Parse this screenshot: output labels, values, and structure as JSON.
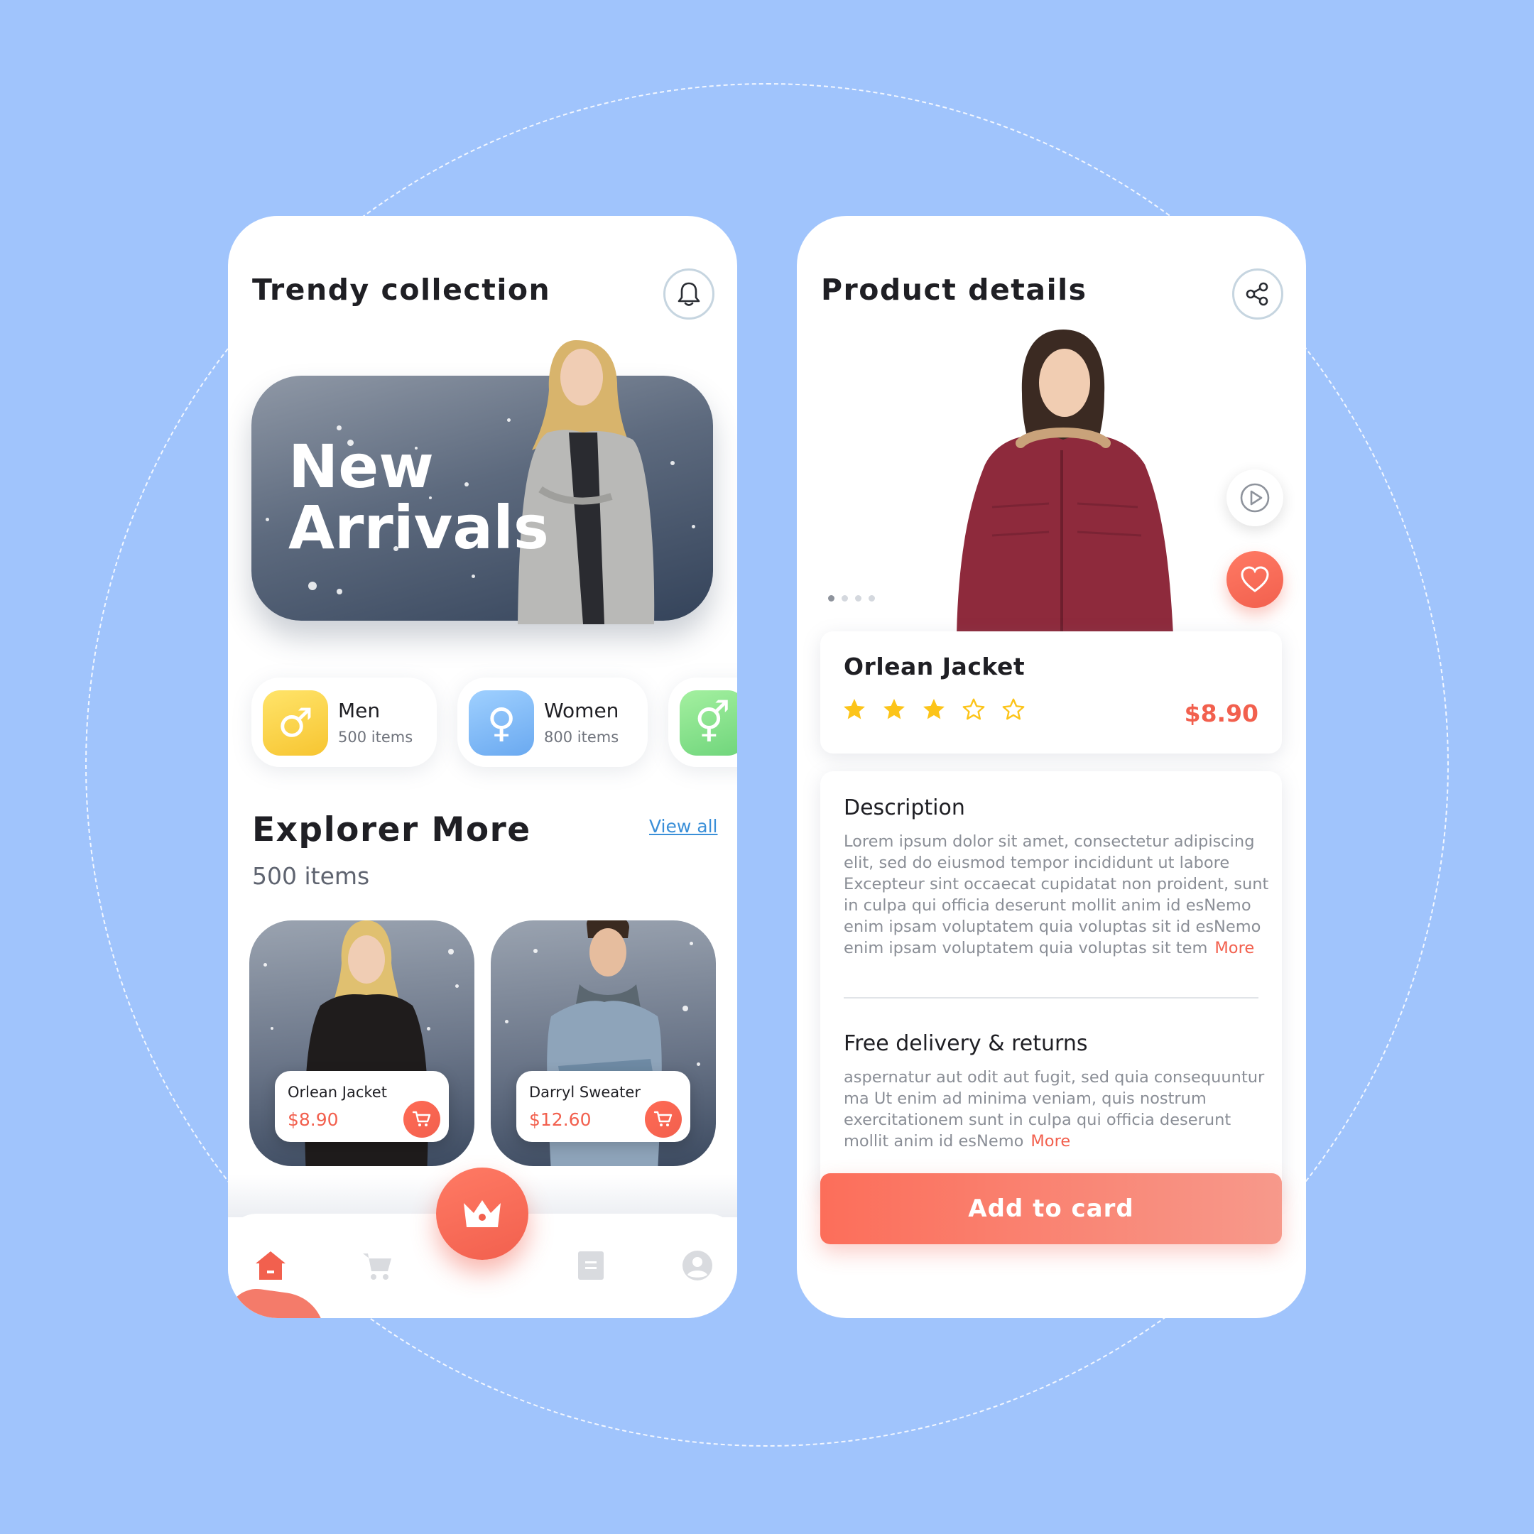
{
  "left_screen": {
    "title": "Trendy collection",
    "icons": {
      "notification": "bell-icon"
    },
    "banner": {
      "line1": "New",
      "line2": "Arrivals"
    },
    "categories": [
      {
        "name": "Men",
        "count": "500 items",
        "icon": "male-symbol-icon",
        "color": "#fbd44a"
      },
      {
        "name": "Women",
        "count": "800 items",
        "icon": "female-symbol-icon",
        "color": "#7fb8f4"
      },
      {
        "name": "",
        "count": "",
        "icon": "unisex-symbol-icon",
        "color": "#7ee08a"
      }
    ],
    "explore": {
      "title": "Explorer More",
      "subtitle": "500 items",
      "view_all": "View all"
    },
    "products": [
      {
        "name": "Orlean Jacket",
        "price": "$8.90"
      },
      {
        "name": "Darryl Sweater",
        "price": "$12.60"
      }
    ],
    "nav": [
      "home-icon",
      "cart-icon",
      "crown-icon",
      "list-icon",
      "profile-icon"
    ]
  },
  "right_screen": {
    "title": "Product details",
    "icons": {
      "share": "share-icon",
      "play": "play-icon",
      "favorite": "heart-icon"
    },
    "gallery": {
      "slides": 4,
      "active": 1
    },
    "product": {
      "name": "Orlean Jacket",
      "price": "$8.90",
      "rating": 3,
      "rating_max": 5
    },
    "description": {
      "heading": "Description",
      "text": "Lorem ipsum dolor sit amet, consectetur adipiscing elit, sed do eiusmod tempor incididunt ut labore Excepteur sint occaecat cupidatat non proident, sunt in culpa qui officia deserunt mollit anim id esNemo enim ipsam voluptatem quia voluptas sit id esNemo enim ipsam voluptatem quia voluptas sit tem",
      "more": "More"
    },
    "delivery": {
      "heading": "Free delivery & returns",
      "text": "aspernatur aut odit aut fugit, sed quia consequuntur ma Ut enim ad minima veniam, quis nostrum exercitationem sunt in culpa qui officia deserunt mollit anim id esNemo",
      "more": "More"
    },
    "add_button": "Add to card"
  },
  "colors": {
    "background": "#a0c4fc",
    "accent": "#f2604e",
    "star": "#fcc419",
    "link": "#3a8fd8"
  }
}
